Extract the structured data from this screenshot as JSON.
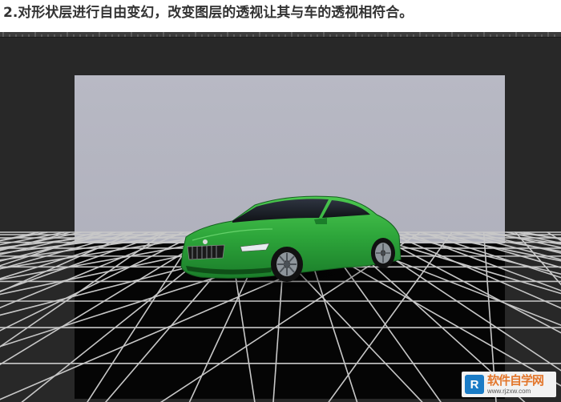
{
  "caption": "2.对形状层进行自由变幻，改变图层的透视让其与车的透视相符合。",
  "watermark": {
    "logo_letter": "R",
    "name": "软件自学网",
    "url": "www.rjzxw.com"
  },
  "colors": {
    "workspace": "#282828",
    "canvas_backdrop": "#b8b9c4",
    "grid_floor": "#000000",
    "grid_line": "#c8c8c8",
    "car_body": "#2da53a"
  },
  "icons": [
    "grid-plane",
    "green-car"
  ]
}
